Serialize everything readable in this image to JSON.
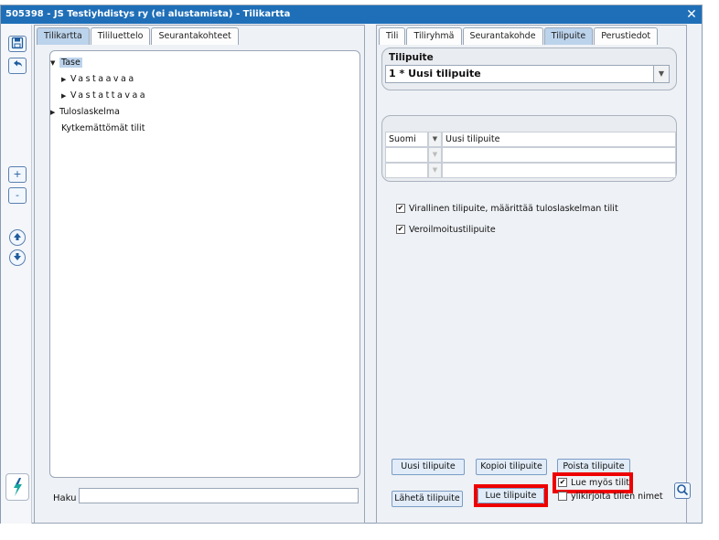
{
  "window": {
    "title": "505398 - JS Testiyhdistys ry (ei alustamista) - Tilikartta",
    "close_glyph": "✕"
  },
  "toolbar": {
    "save_icon": "save-icon",
    "undo_icon": "undo-icon",
    "plus_label": "+",
    "minus_label": "-",
    "up_icon": "arrow-up-icon",
    "down_icon": "arrow-down-icon",
    "logo_icon": "app-logo-icon"
  },
  "left": {
    "tabs": [
      "Tilikartta",
      "Tililuettelo",
      "Seurantakohteet"
    ],
    "active_tab": "Tilikartta",
    "tree": [
      {
        "label": "Tase",
        "expanded": true,
        "level": 0
      },
      {
        "label": "Vastaavaa",
        "expanded": false,
        "level": 1
      },
      {
        "label": "Vastattavaa",
        "expanded": false,
        "level": 1
      },
      {
        "label": "Tuloslaskelma",
        "expanded": false,
        "level": 0
      },
      {
        "label": "Kytkemättömät tilit",
        "level": 0
      }
    ],
    "search_label": "Haku",
    "search_value": ""
  },
  "right": {
    "tabs": [
      "Tili",
      "Tiliryhmä",
      "Seurantakohde",
      "Tilipuite",
      "Perustiedot"
    ],
    "active_tab": "Tilipuite",
    "group_label": "Tilipuite",
    "selected_tilipuite": "1 * Uusi tilipuite",
    "names_table": [
      {
        "language": "Suomi",
        "name": "Uusi tilipuite"
      },
      {
        "language": "",
        "name": ""
      },
      {
        "language": "",
        "name": ""
      }
    ],
    "checkbox_official": "Virallinen tilipuite, määrittää tuloslaskelman tilit",
    "checkbox_official_checked": true,
    "checkbox_tax": "Veroilmoitustilipuite",
    "checkbox_tax_checked": true,
    "buttons": {
      "new": "Uusi tilipuite",
      "copy": "Kopioi tilipuite",
      "delete": "Poista tilipuite",
      "send": "Lähetä tilipuite",
      "read": "Lue tilipuite"
    },
    "checkbox_read_accounts": "Lue myös tilit",
    "checkbox_read_accounts_checked": true,
    "checkbox_overwrite": "ylikirjoita tilien nimet",
    "checkbox_overwrite_checked": false,
    "search_icon": "search-icon"
  },
  "colors": {
    "titlebar": "#1f6fb8",
    "active_tab": "#bcd3ec",
    "highlight": "#ee0000"
  }
}
